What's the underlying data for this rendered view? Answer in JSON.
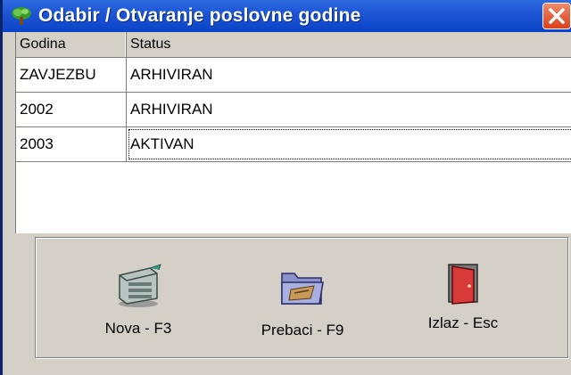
{
  "window": {
    "title": "Odabir / Otvaranje poslovne godine",
    "title_bar_color": "#1d55d4",
    "close_button_color": "#d8401c"
  },
  "grid": {
    "columns": [
      "Godina",
      "Status"
    ],
    "rows": [
      {
        "godina": "ZAVJEZBU",
        "status": "ARHIVIRAN"
      },
      {
        "godina": "2002",
        "status": "ARHIVIRAN"
      },
      {
        "godina": "2003",
        "status": "AKTIVAN"
      }
    ]
  },
  "actions": {
    "new_label": "Nova - F3",
    "new_icon": "server-icon",
    "transfer_label": "Prebaci - F9",
    "transfer_icon": "folder-icon",
    "exit_label": "Izlaz - Esc",
    "exit_icon": "door-icon"
  }
}
